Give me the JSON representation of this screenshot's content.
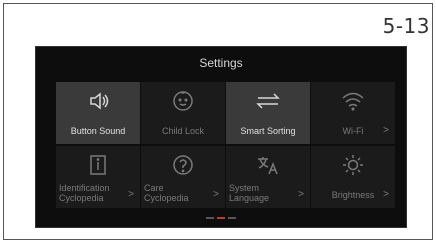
{
  "page_number": "5-13",
  "screen": {
    "title": "Settings",
    "tiles": [
      {
        "label": "Button Sound",
        "icon": "speaker-icon",
        "selected": true
      },
      {
        "label": "Child Lock",
        "icon": "baby-face-icon",
        "selected": false
      },
      {
        "label": "Smart Sorting",
        "icon": "swap-arrows-icon",
        "selected": true
      },
      {
        "label": "Wi-Fi",
        "icon": "wifi-icon",
        "selected": false
      },
      {
        "label": "Identification Cyclopedia",
        "line1": "Identification",
        "line2": "Cyclopedia",
        "icon": "info-icon",
        "selected": false
      },
      {
        "label": "Care Cyclopedia",
        "line1": "Care",
        "line2": "Cyclopedia",
        "icon": "question-icon",
        "selected": false
      },
      {
        "label": "System Language",
        "line1": "System",
        "line2": "Language",
        "icon": "translate-icon",
        "selected": false
      },
      {
        "label": "Brightness",
        "icon": "sun-icon",
        "selected": false
      }
    ],
    "page_indicator": {
      "pages": 3,
      "active": 2
    }
  }
}
